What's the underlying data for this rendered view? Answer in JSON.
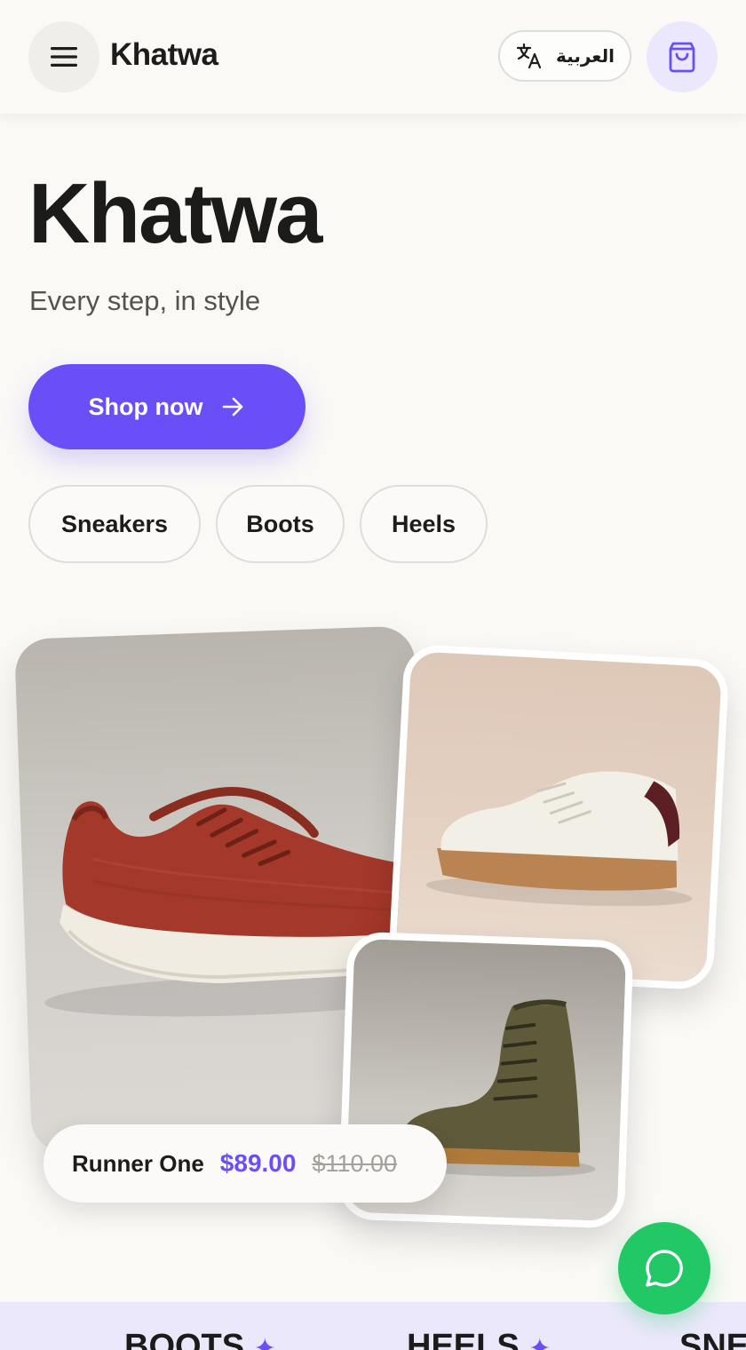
{
  "header": {
    "brand": "Khatwa",
    "language_label": "العربية",
    "icons": {
      "menu": "hamburger-menu-icon",
      "language": "translate-icon",
      "cart": "shopping-bag-icon"
    }
  },
  "hero": {
    "title": "Khatwa",
    "subtitle": "Every step, in style",
    "cta_label": "Shop now"
  },
  "categories": [
    "Sneakers",
    "Boots",
    "Heels"
  ],
  "featured": {
    "name": "Runner One",
    "price": "$89.00",
    "old_price": "$110.00"
  },
  "marquee": {
    "items": [
      "BOOTS",
      "HEELS",
      "SNE"
    ]
  },
  "colors": {
    "accent": "#6a4ff8",
    "whatsapp": "#22c865",
    "background": "#faf9f6",
    "marquee_bg": "#ece8fb"
  }
}
